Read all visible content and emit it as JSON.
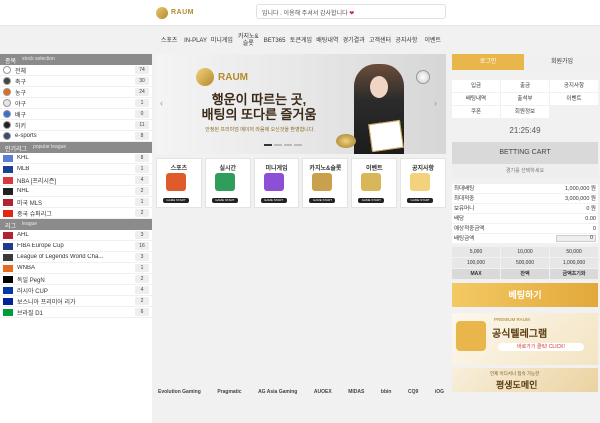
{
  "header": {
    "logo_text": "RAUM",
    "marquee": "입니다 . 이용해 주셔서 감사합니다 ",
    "heart": "❤"
  },
  "nav": [
    "스포츠",
    "IN-PLAY",
    "미니게임",
    "카지노&슬롯",
    "BET365",
    "토큰게임",
    "배팅내역",
    "경기결과",
    "고객센터",
    "공지사항",
    "이벤트"
  ],
  "left": {
    "sports_head": {
      "title": "종목",
      "sub": "stock selection"
    },
    "sports": [
      {
        "label": "전체",
        "count": "74",
        "color": "#ffffff"
      },
      {
        "label": "축구",
        "count": "30",
        "color": "#444444"
      },
      {
        "label": "농구",
        "count": "24",
        "color": "#e46b1f"
      },
      {
        "label": "야구",
        "count": "1",
        "color": "#e6e6e6"
      },
      {
        "label": "배구",
        "count": "0",
        "color": "#3a6fd1"
      },
      {
        "label": "하키",
        "count": "11",
        "color": "#222222"
      },
      {
        "label": "e-sports",
        "count": "8",
        "color": "#3b4a6b"
      }
    ],
    "popular_head": {
      "title": "인기리그",
      "sub": "popular league"
    },
    "popular": [
      {
        "label": "KHL",
        "count": "8",
        "flag": "#5b7dd6"
      },
      {
        "label": "MLB",
        "count": "1",
        "flag": "#1d3f8f"
      },
      {
        "label": "NBA [프리시즌]",
        "count": "4",
        "flag": "#d63b3b"
      },
      {
        "label": "NHL",
        "count": "2",
        "flag": "#222222"
      },
      {
        "label": "미국 MLS",
        "count": "1",
        "flag": "#b22234"
      },
      {
        "label": "중국 슈퍼리그",
        "count": "2",
        "flag": "#de2910"
      }
    ],
    "league_head": {
      "title": "리그",
      "sub": "league"
    },
    "leagues": [
      {
        "label": "AHL",
        "count": "3",
        "flag": "#b22234"
      },
      {
        "label": "FIBA Europe Cup",
        "count": "16",
        "flag": "#1f3b8f"
      },
      {
        "label": "League of Legends World Cha...",
        "count": "3",
        "flag": "#3a3a3a"
      },
      {
        "label": "WNBA",
        "count": "1",
        "flag": "#e46b1f"
      },
      {
        "label": "독일 PegN",
        "count": "2",
        "flag": "#000000"
      },
      {
        "label": "러시아 CUP",
        "count": "4",
        "flag": "#0039a6"
      },
      {
        "label": "보스니아 프리미어 리가",
        "count": "2",
        "flag": "#002395"
      },
      {
        "label": "브라질 D1",
        "count": "6",
        "flag": "#009c3b"
      }
    ]
  },
  "banner": {
    "logo": "RAUM",
    "title_line1": "행운이 따르는 곳,",
    "title_line2": "배팅의 또다른 즐거움",
    "sub": "안정된 프리미엄 메이저 라움에 오신것을 환영합니다."
  },
  "tiles": [
    {
      "label": "스포츠",
      "btn": "GAME START",
      "color": "#e05b2a"
    },
    {
      "label": "실시간",
      "btn": "GAME START",
      "color": "#2f9e5a"
    },
    {
      "label": "미니게임",
      "btn": "GAME START",
      "color": "#8c4fd6"
    },
    {
      "label": "카지노&슬롯",
      "btn": "GAME START",
      "color": "#c9a04b"
    },
    {
      "label": "이벤트",
      "btn": "GAME START",
      "color": "#d8b65a"
    },
    {
      "label": "공지사항",
      "btn": "GAME START",
      "color": "#f2d27b"
    }
  ],
  "partners": [
    "Evolution Gaming",
    "Pragmatic",
    "AG Asia Gaming",
    "AUOEX",
    "MIDAS",
    "bbin",
    "CQ9",
    "iOG"
  ],
  "right": {
    "login": "로그인",
    "register": "회원가입",
    "menu": [
      "입금",
      "출금",
      "공지사항",
      "출석부",
      "이벤트",
      "쿠폰",
      "회원정보",
      "배팅내역"
    ],
    "menu_order": [
      "입금",
      "출금",
      "공지사항",
      "배팅내역",
      "출석부",
      "이벤트",
      "쿠폰",
      "회원정보"
    ],
    "clock": "21:25:49",
    "betting_cart": "BETTING CART",
    "cart_empty": "경기를 선택하세요",
    "info": [
      {
        "label": "최대배팅",
        "value": "1,000,000 원"
      },
      {
        "label": "최대적중",
        "value": "3,000,000 원"
      },
      {
        "label": "보유머니",
        "value": "0 원"
      },
      {
        "label": "배당",
        "value": "0.00"
      },
      {
        "label": "예상적중금액",
        "value": "0"
      }
    ],
    "bet_amount_label": "배팅금액",
    "bet_amount_value": "0",
    "amounts": [
      "5,000",
      "10,000",
      "50,000",
      "100,000",
      "500,000",
      "1,000,000",
      "MAX",
      "잔액",
      "금액초기화"
    ],
    "bet_button": "베팅하기",
    "promo_tag": "PREMIUM RAUM",
    "promo_title": "공식텔레그램",
    "promo_btn": "바로가기 클릭! CLICK!",
    "promo2_t1": "언제 어디서나 접속 가능한",
    "promo2_t2": "평생도메인"
  }
}
